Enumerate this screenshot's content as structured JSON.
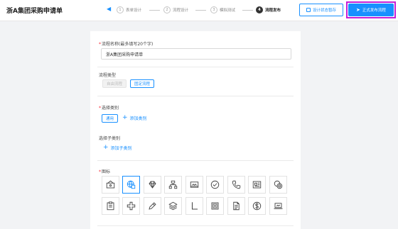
{
  "header": {
    "title": "浙A集团采购申请单",
    "back_icon": "chevron-left-icon",
    "steps": [
      {
        "num": "1",
        "label": "表单设计"
      },
      {
        "num": "2",
        "label": "流程设计"
      },
      {
        "num": "3",
        "label": "模拟测试"
      },
      {
        "num": "4",
        "label": "流程发布"
      }
    ],
    "active_step": 4,
    "save_label": "设计状态暂存",
    "publish_label": "正式发布流程"
  },
  "form": {
    "name_label": "流程名称(最多填写20个字)",
    "name_value": "浙A集团采购申请单",
    "type_label": "流程类型",
    "type_options": [
      "自由流程",
      "固定流程"
    ],
    "type_selected": "固定流程",
    "category_label": "选择类别",
    "category_selected": "通用",
    "add_category": "添加类别",
    "subcategory_label": "选择子类别",
    "add_subcategory": "添加子类别",
    "icon_label": "图标",
    "icons_row1": [
      "vault-icon",
      "globe-cube-icon",
      "diamond-icon",
      "network-icon",
      "envelope-icon",
      "check-circle-icon",
      "phone-icon",
      "newspaper-icon",
      "coins-icon"
    ],
    "icons_row2": [
      "clipboard-icon",
      "plus-cross-icon",
      "edit-icon",
      "layers-icon",
      "corner-icon",
      "safe-icon",
      "document-icon",
      "dollar-icon",
      "laptop-icon"
    ],
    "selected_icon": "globe-cube-icon"
  },
  "colors": {
    "accent": "#1890ff",
    "highlight_frame": "#c51fd6",
    "required": "#f5222d"
  }
}
